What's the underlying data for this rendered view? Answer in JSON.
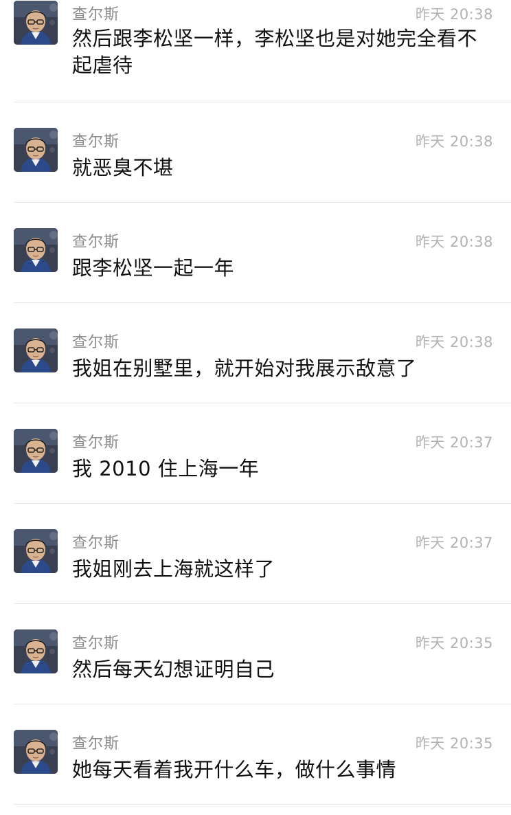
{
  "messages": [
    {
      "sender": "查尔斯",
      "time": "昨天 20:38",
      "text": "然后跟李松坚一样，李松坚也是对她完全看不起虐待"
    },
    {
      "sender": "查尔斯",
      "time": "昨天 20:38",
      "text": "就恶臭不堪"
    },
    {
      "sender": "查尔斯",
      "time": "昨天 20:38",
      "text": "跟李松坚一起一年"
    },
    {
      "sender": "查尔斯",
      "time": "昨天 20:38",
      "text": "我姐在别墅里，就开始对我展示敌意了"
    },
    {
      "sender": "查尔斯",
      "time": "昨天 20:37",
      "text": "我 2010 住上海一年"
    },
    {
      "sender": "查尔斯",
      "time": "昨天 20:37",
      "text": "我姐刚去上海就这样了"
    },
    {
      "sender": "查尔斯",
      "time": "昨天 20:35",
      "text": "然后每天幻想证明自己"
    },
    {
      "sender": "查尔斯",
      "time": "昨天 20:35",
      "text": "她每天看着我开什么车，做什么事情"
    }
  ],
  "colors": {
    "sender": "#8c8c8c",
    "time": "#b2b2b2",
    "text": "#111111",
    "divider": "#e6e6e6"
  },
  "icons": {
    "avatar": "user-avatar-photo"
  }
}
